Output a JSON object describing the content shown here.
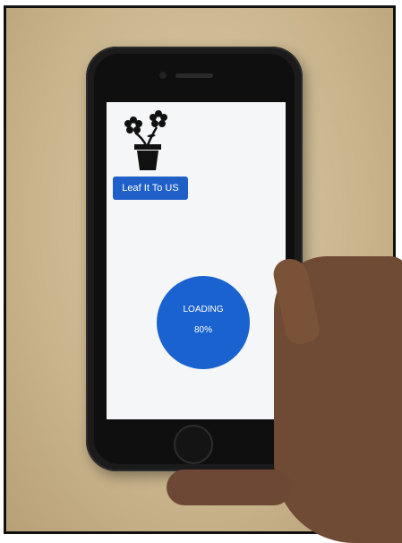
{
  "app": {
    "brand_button_label": "Leaf It To US",
    "loading_label": "LOADING",
    "loading_progress": "80%"
  },
  "icons": {
    "logo": "potted-flower-icon"
  },
  "colors": {
    "accent_blue": "#1a62d0",
    "button_blue": "#1f5fc8",
    "screen_bg": "#f5f6f7"
  }
}
